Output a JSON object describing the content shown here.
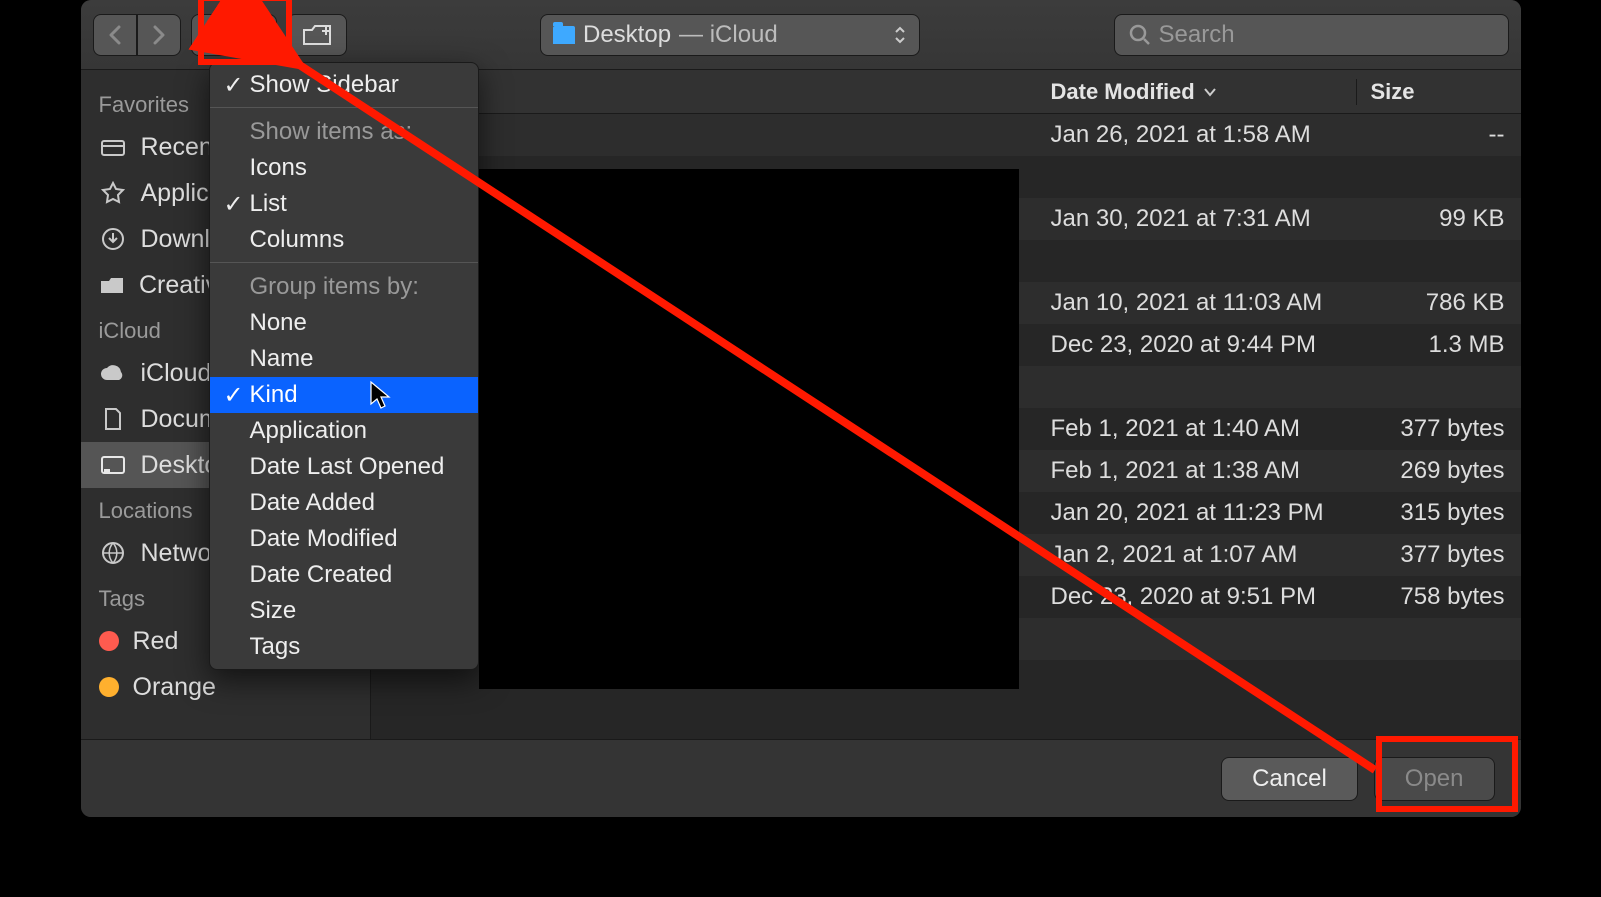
{
  "toolbar": {
    "location_folder": "Desktop",
    "location_suffix": " — iCloud",
    "search_placeholder": "Search"
  },
  "sidebar": {
    "sections": [
      {
        "title": "Favorites",
        "items": [
          {
            "label": "Recents",
            "icon": "recents"
          },
          {
            "label": "Applications",
            "icon": "apps"
          },
          {
            "label": "Downloads",
            "icon": "downloads"
          },
          {
            "label": "Creative Cloud Files",
            "icon": "folder"
          }
        ]
      },
      {
        "title": "iCloud",
        "items": [
          {
            "label": "iCloud Drive",
            "icon": "cloud"
          },
          {
            "label": "Documents",
            "icon": "docs"
          },
          {
            "label": "Desktop",
            "icon": "desktop",
            "selected": true
          }
        ]
      },
      {
        "title": "Locations",
        "items": [
          {
            "label": "Network",
            "icon": "network"
          }
        ]
      },
      {
        "title": "Tags",
        "items": [
          {
            "label": "Red",
            "icon": "tag",
            "color": "#ff5b4f"
          },
          {
            "label": "Orange",
            "icon": "tag",
            "color": "#ffb02e"
          }
        ]
      }
    ]
  },
  "columns": {
    "date": "Date Modified",
    "size": "Size"
  },
  "rows": [
    {
      "date": "Jan 26, 2021 at 1:58 AM",
      "size": "--"
    },
    {
      "date": "",
      "size": ""
    },
    {
      "date": "Jan 30, 2021 at 7:31 AM",
      "size": "99 KB"
    },
    {
      "date": "",
      "size": ""
    },
    {
      "date": "Jan 10, 2021 at 11:03 AM",
      "size": "786 KB"
    },
    {
      "date": "Dec 23, 2020 at 9:44 PM",
      "size": "1.3 MB"
    },
    {
      "date": "",
      "size": ""
    },
    {
      "date": "Feb 1, 2021 at 1:40 AM",
      "size": "377 bytes"
    },
    {
      "date": "Feb 1, 2021 at 1:38 AM",
      "size": "269 bytes"
    },
    {
      "date": "Jan 20, 2021 at 11:23 PM",
      "size": "315 bytes"
    },
    {
      "date": "Jan 2, 2021 at 1:07 AM",
      "size": "377 bytes"
    },
    {
      "date": "Dec 23, 2020 at 9:51 PM",
      "size": "758 bytes"
    },
    {
      "date": "",
      "size": ""
    },
    {
      "date": "",
      "size": ""
    }
  ],
  "footer": {
    "cancel": "Cancel",
    "open": "Open"
  },
  "menu": {
    "show_sidebar": "Show Sidebar",
    "show_items_as": "Show items as:",
    "icons": "Icons",
    "list": "List",
    "columns": "Columns",
    "group_by": "Group items by:",
    "none": "None",
    "name": "Name",
    "kind": "Kind",
    "application": "Application",
    "date_last_opened": "Date Last Opened",
    "date_added": "Date Added",
    "date_modified": "Date Modified",
    "date_created": "Date Created",
    "size": "Size",
    "tags": "Tags"
  }
}
